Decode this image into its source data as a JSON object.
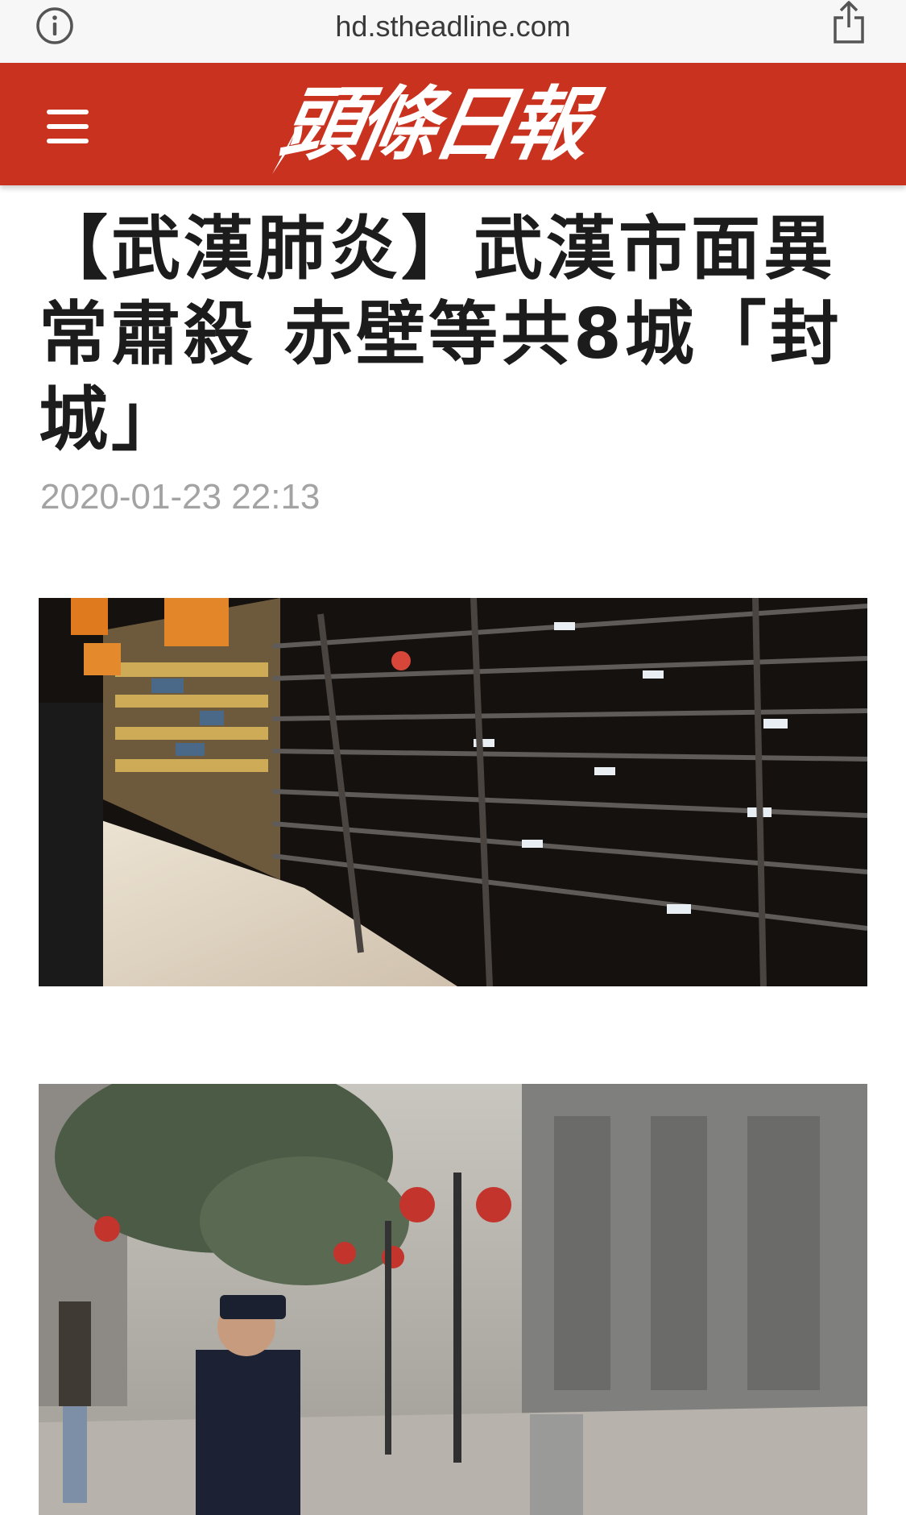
{
  "browser": {
    "url": "hd.stheadline.com",
    "left_icon": "info-icon",
    "right_icon": "share-icon"
  },
  "site": {
    "brand_color": "#c9321f",
    "logo_text": "頭條日報",
    "menu_icon": "hamburger-menu-icon"
  },
  "article": {
    "title": "【武漢肺炎】武漢市面異常肅殺 赤壁等共8城「封城」",
    "timestamp": "2020-01-23 22:13",
    "images": [
      {
        "subject": "empty-supermarket-shelves-photo"
      },
      {
        "subject": "deserted-pedestrian-street-photo"
      }
    ]
  }
}
